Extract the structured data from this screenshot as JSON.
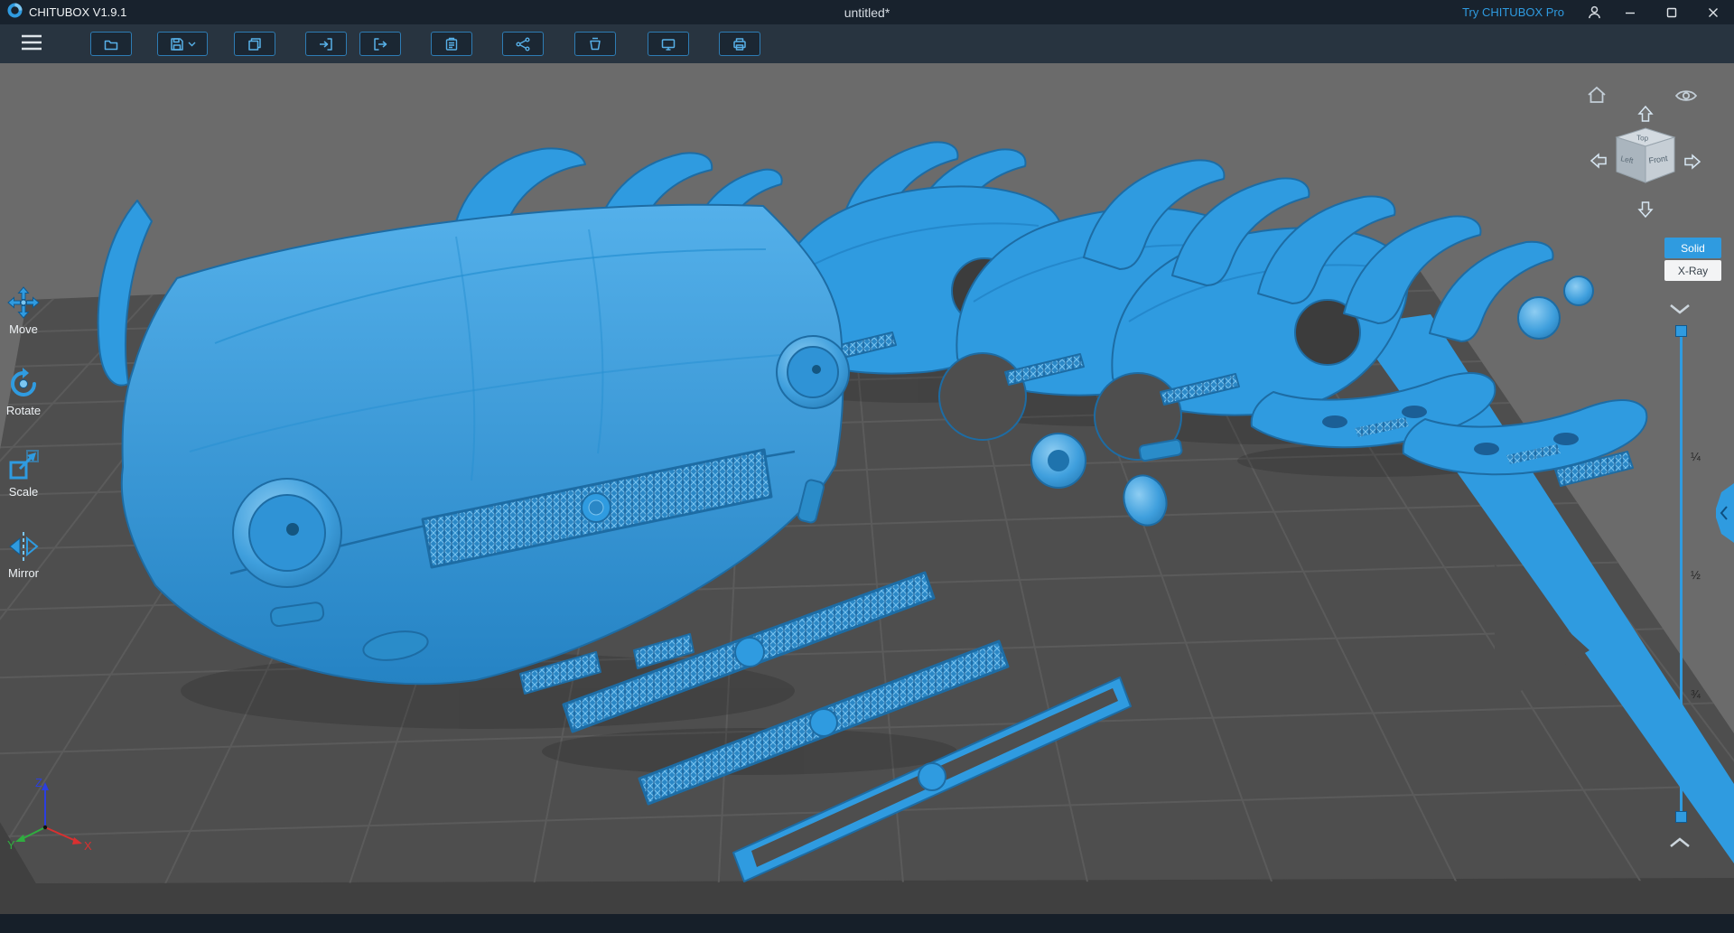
{
  "titlebar": {
    "app_title": "CHITUBOX V1.9.1",
    "document_title": "untitled*",
    "pro_link": "Try CHITUBOX Pro"
  },
  "toolbar": {
    "buttons": [
      {
        "name": "open-file",
        "icon": "folder-icon"
      },
      {
        "name": "save",
        "icon": "save-icon",
        "has_dropdown": true
      },
      {
        "name": "copy",
        "icon": "copy-icon"
      },
      {
        "name": "import-model",
        "icon": "arrow-into-bracket-icon"
      },
      {
        "name": "export-model",
        "icon": "arrow-out-of-bracket-icon"
      },
      {
        "name": "clipboard",
        "icon": "clipboard-icon"
      },
      {
        "name": "network-sending",
        "icon": "network-nodes-icon"
      },
      {
        "name": "resin-vat",
        "icon": "vat-icon"
      },
      {
        "name": "screen-test",
        "icon": "screen-icon"
      },
      {
        "name": "printer",
        "icon": "printer-icon"
      }
    ]
  },
  "left_tools": {
    "items": [
      {
        "label": "Move",
        "icon": "move-icon"
      },
      {
        "label": "Rotate",
        "icon": "rotate-icon"
      },
      {
        "label": "Scale",
        "icon": "scale-icon"
      },
      {
        "label": "Mirror",
        "icon": "mirror-icon"
      }
    ]
  },
  "view_controls": {
    "cube": {
      "top_label": "Top",
      "left_label": "Left",
      "front_label": "Front"
    },
    "render_modes": [
      {
        "label": "Solid",
        "active": true
      },
      {
        "label": "X-Ray",
        "active": false
      }
    ],
    "clip_fractions": [
      "¼",
      "½",
      "¾"
    ]
  },
  "axes": {
    "x_label": "X",
    "y_label": "Y",
    "z_label": "Z"
  },
  "scene": {
    "description": "Blue 3D-printable classic car body parts (front clip with grille and headlights, fenders, three body shells, bumpers, headlight pods, grille slats) laid out on a gray perspective build plate with a blue right edge band"
  },
  "colors": {
    "accent_blue": "#2f9be0",
    "titlebar_bg": "#18222d",
    "toolbar_bg": "#283440",
    "viewport_bg": "#6b6b6b",
    "build_plate": "#4e4e4e",
    "model_blue": "#2f9be0"
  }
}
